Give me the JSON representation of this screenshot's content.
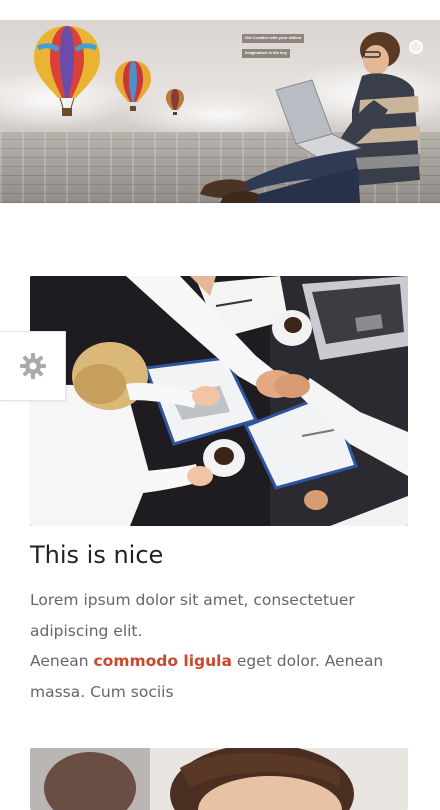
{
  "hero": {
    "caption_line_1": "Get Creative with your skilled",
    "caption_line_2": "Imagination is the key",
    "image_subject": "man with laptop on wooden floor with hot air balloons"
  },
  "settings": {
    "icon": "gear-icon"
  },
  "card": {
    "image_subject": "business handshake over desk",
    "title": "This is nice",
    "text_line_1": "Lorem ipsum dolor sit amet, consectetuer adipiscing elit.",
    "text_prefix": "Aenean ",
    "text_link": "commodo ligula",
    "text_suffix": " eget dolor. Aenean massa. Cum sociis"
  },
  "next_card": {
    "image_subject": "woman portrait"
  },
  "colors": {
    "accent": "#c9492a",
    "text": "#666666",
    "title": "#222222",
    "gear": "#aaaaaa"
  }
}
